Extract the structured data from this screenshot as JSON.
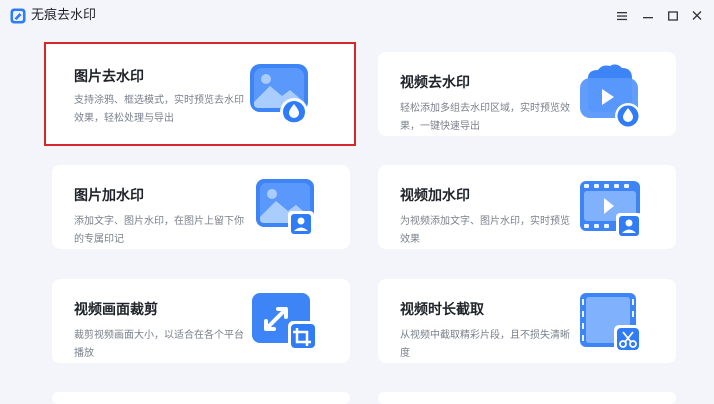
{
  "window": {
    "title": "无痕去水印",
    "controls": [
      "menu-icon",
      "minimize-icon",
      "maximize-icon",
      "close-icon"
    ]
  },
  "cards": [
    {
      "title": "图片去水印",
      "desc": "支持涂鸦、框选模式，实时预览去水印效果，轻松处理与导出",
      "icon": "image-remove-watermark-icon",
      "selected": true
    },
    {
      "title": "视频去水印",
      "desc": "轻松添加多组去水印区域，实时预览效果，一键快速导出",
      "icon": "video-remove-watermark-icon",
      "selected": false
    },
    {
      "title": "图片加水印",
      "desc": "添加文字、图片水印，在图片上留下你的专属印记",
      "icon": "image-add-watermark-icon",
      "selected": false
    },
    {
      "title": "视频加水印",
      "desc": "为视频添加文字、图片水印，实时预览效果",
      "icon": "video-add-watermark-icon",
      "selected": false
    },
    {
      "title": "视频画面裁剪",
      "desc": "裁剪视频画面大小，以适合在各个平台播放",
      "icon": "video-crop-icon",
      "selected": false
    },
    {
      "title": "视频时长截取",
      "desc": "从视频中截取精彩片段，且不损失清晰度",
      "icon": "video-trim-icon",
      "selected": false
    }
  ],
  "colors": {
    "accent": "#2f7cf6",
    "selection": "#d9262c",
    "background": "#f3f5fa"
  }
}
